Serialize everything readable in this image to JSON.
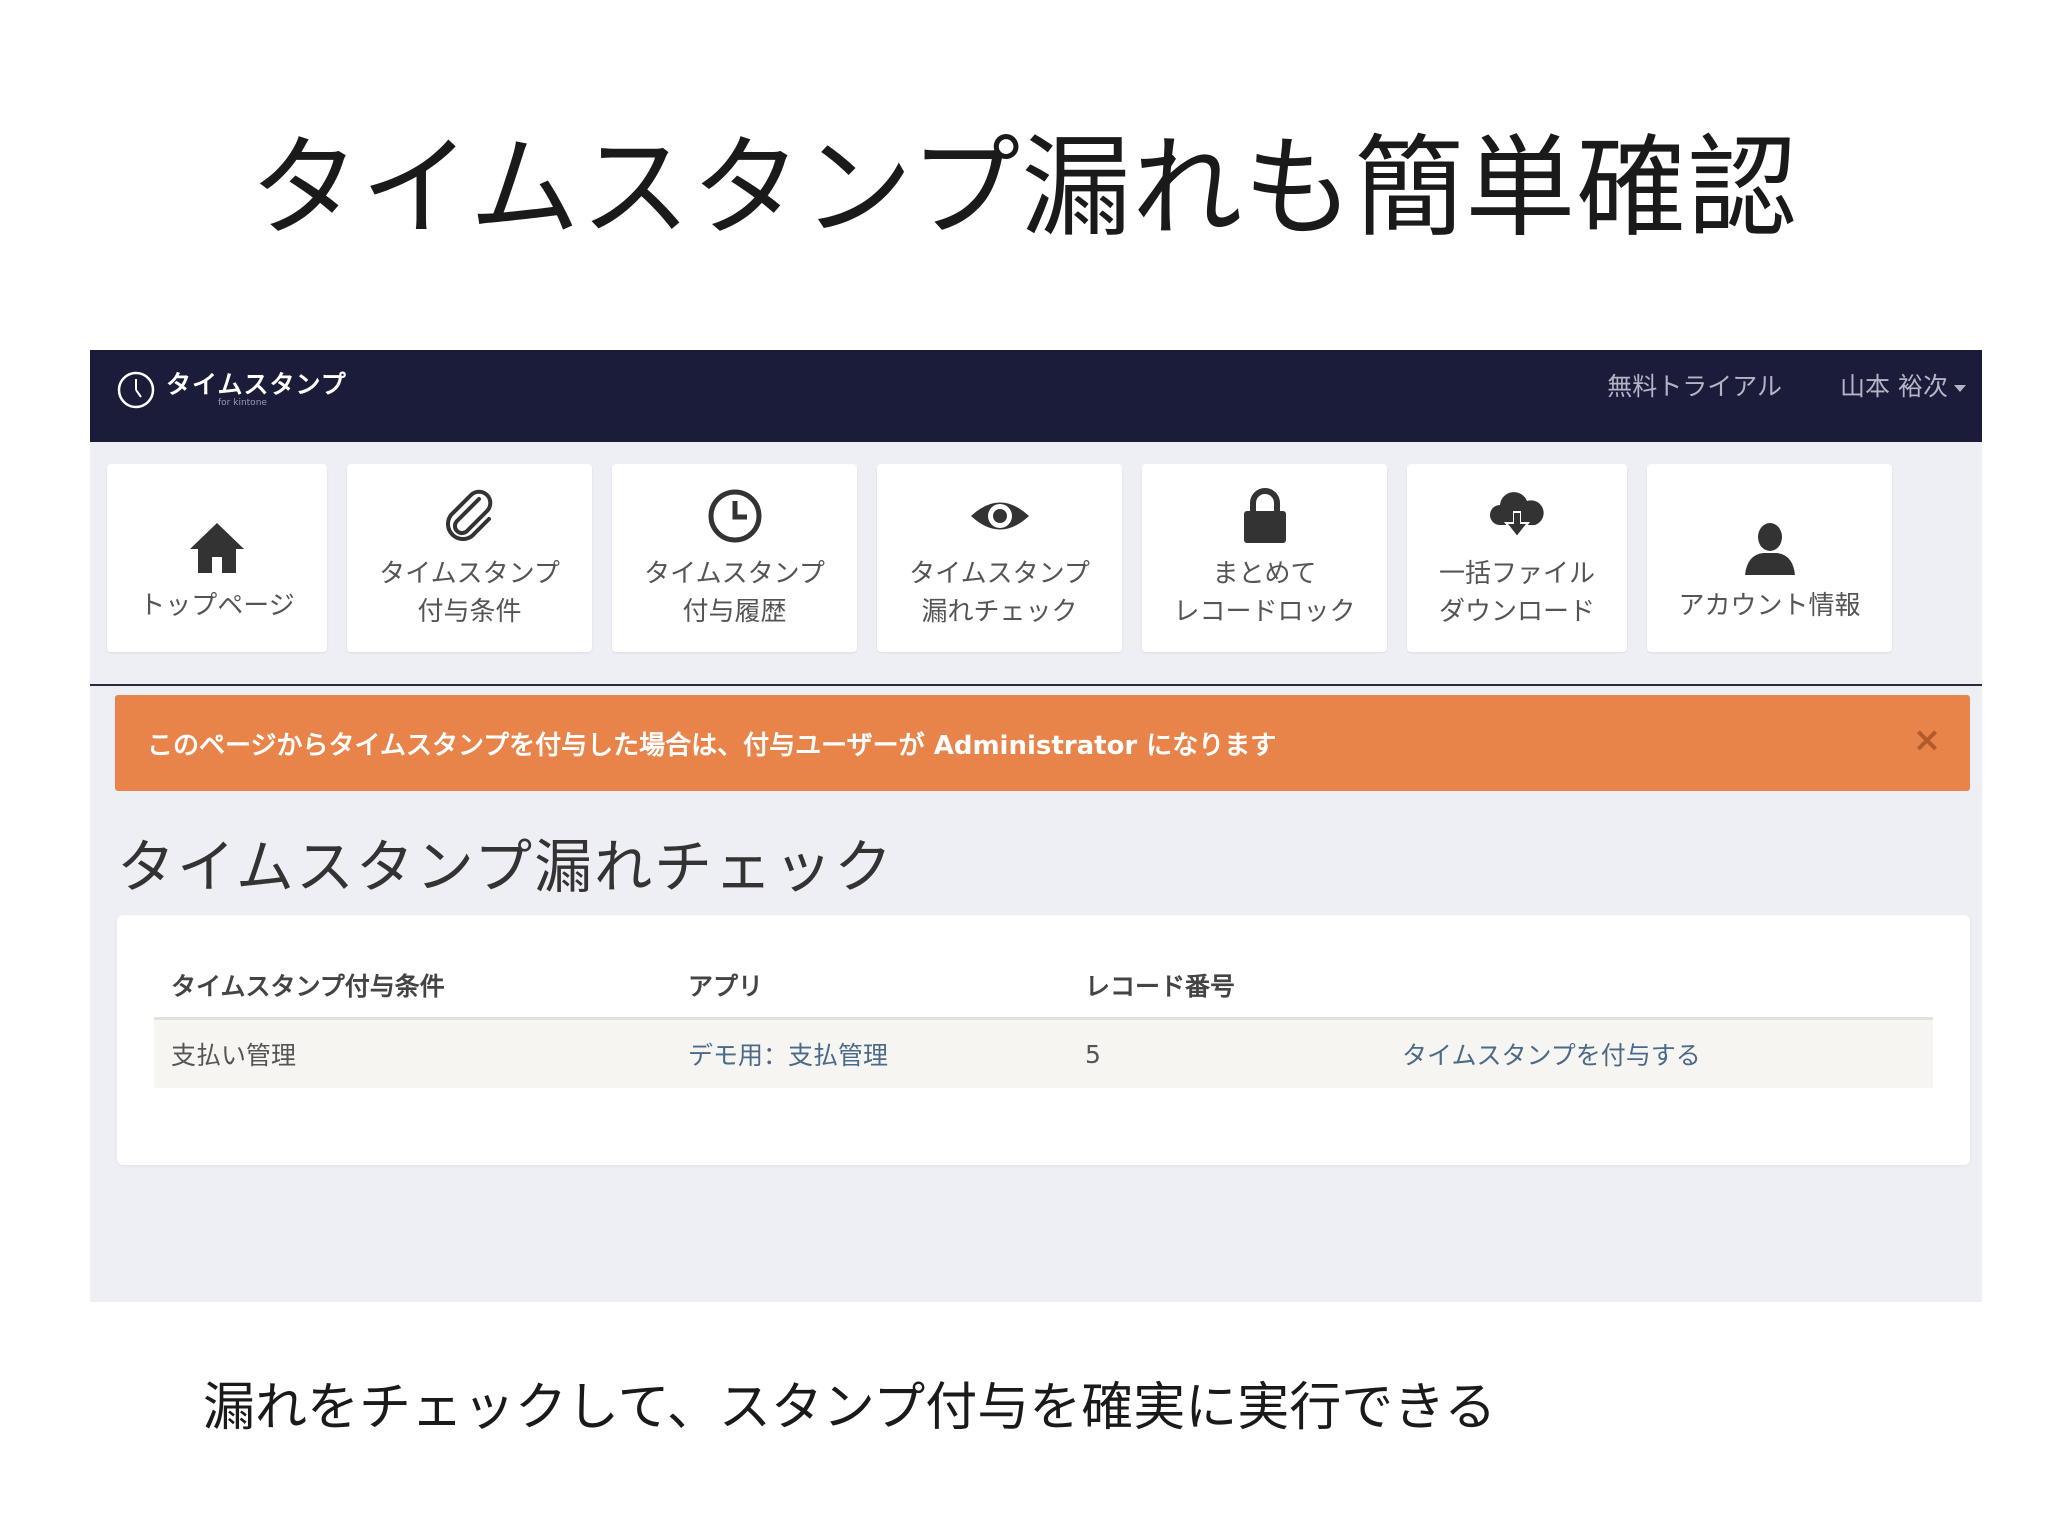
{
  "slide": {
    "title": "タイムスタンプ漏れも簡単確認",
    "caption": "漏れをチェックして、スタンプ付与を確実に実行できる"
  },
  "navbar": {
    "brand_name": "タイムスタンプ",
    "brand_sub": "for kintone",
    "trial_link": "無料トライアル",
    "user_name": "山本 裕次"
  },
  "tiles": [
    {
      "icon": "home-icon",
      "label": "トップページ"
    },
    {
      "icon": "paperclip-icon",
      "label": "タイムスタンプ\n付与条件"
    },
    {
      "icon": "clock-icon",
      "label": "タイムスタンプ\n付与履歴"
    },
    {
      "icon": "eye-icon",
      "label": "タイムスタンプ\n漏れチェック"
    },
    {
      "icon": "lock-icon",
      "label": "まとめて\nレコードロック"
    },
    {
      "icon": "cloud-download-icon",
      "label": "一括ファイル\nダウンロード"
    },
    {
      "icon": "user-icon",
      "label": "アカウント情報"
    }
  ],
  "alert": {
    "message": "このページからタイムスタンプを付与した場合は、付与ユーザーが Administrator になります",
    "close": "×",
    "color": "#e8834a"
  },
  "page": {
    "heading": "タイムスタンプ漏れチェック"
  },
  "table": {
    "headers": [
      "タイムスタンプ付与条件",
      "アプリ",
      "レコード番号",
      ""
    ],
    "rows": [
      {
        "condition": "支払い管理",
        "app": "デモ用：支払管理",
        "record": "5",
        "action": "タイムスタンプを付与する"
      }
    ]
  },
  "colors": {
    "navbar": "#1a1c3a",
    "background": "#eeeef5",
    "link": "#4a6a8a"
  }
}
